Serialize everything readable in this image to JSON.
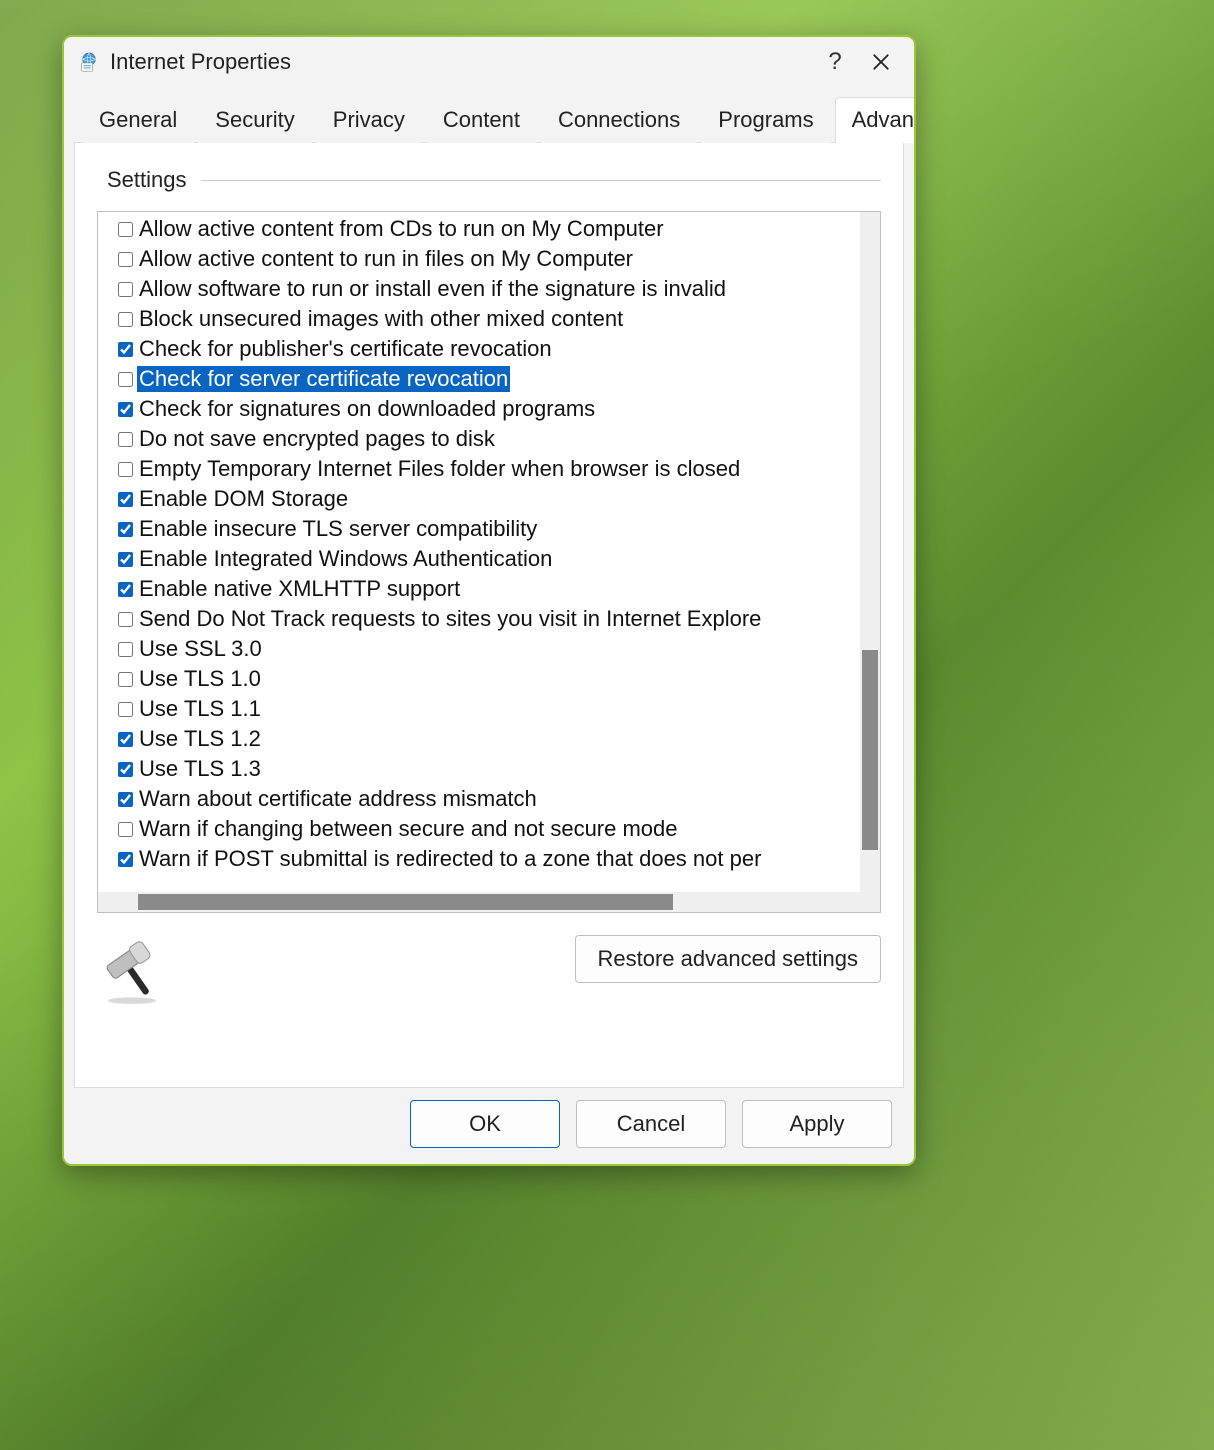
{
  "window": {
    "title": "Internet Properties"
  },
  "tabs": [
    {
      "label": "General",
      "active": false
    },
    {
      "label": "Security",
      "active": false
    },
    {
      "label": "Privacy",
      "active": false
    },
    {
      "label": "Content",
      "active": false
    },
    {
      "label": "Connections",
      "active": false
    },
    {
      "label": "Programs",
      "active": false
    },
    {
      "label": "Advanced",
      "active": true
    }
  ],
  "group": {
    "title": "Settings"
  },
  "settings": [
    {
      "label": "Allow active content from CDs to run on My Computer",
      "checked": false,
      "selected": false
    },
    {
      "label": "Allow active content to run in files on My Computer",
      "checked": false,
      "selected": false
    },
    {
      "label": "Allow software to run or install even if the signature is invalid",
      "checked": false,
      "selected": false
    },
    {
      "label": "Block unsecured images with other mixed content",
      "checked": false,
      "selected": false
    },
    {
      "label": "Check for publisher's certificate revocation",
      "checked": true,
      "selected": false
    },
    {
      "label": "Check for server certificate revocation",
      "checked": false,
      "selected": true
    },
    {
      "label": "Check for signatures on downloaded programs",
      "checked": true,
      "selected": false
    },
    {
      "label": "Do not save encrypted pages to disk",
      "checked": false,
      "selected": false
    },
    {
      "label": "Empty Temporary Internet Files folder when browser is closed",
      "checked": false,
      "selected": false
    },
    {
      "label": "Enable DOM Storage",
      "checked": true,
      "selected": false
    },
    {
      "label": "Enable insecure TLS server compatibility",
      "checked": true,
      "selected": false
    },
    {
      "label": "Enable Integrated Windows Authentication",
      "checked": true,
      "selected": false
    },
    {
      "label": "Enable native XMLHTTP support",
      "checked": true,
      "selected": false
    },
    {
      "label": "Send Do Not Track requests to sites you visit in Internet Explore",
      "checked": false,
      "selected": false
    },
    {
      "label": "Use SSL 3.0",
      "checked": false,
      "selected": false
    },
    {
      "label": "Use TLS 1.0",
      "checked": false,
      "selected": false
    },
    {
      "label": "Use TLS 1.1",
      "checked": false,
      "selected": false
    },
    {
      "label": "Use TLS 1.2",
      "checked": true,
      "selected": false
    },
    {
      "label": "Use TLS 1.3",
      "checked": true,
      "selected": false
    },
    {
      "label": "Warn about certificate address mismatch",
      "checked": true,
      "selected": false
    },
    {
      "label": "Warn if changing between secure and not secure mode",
      "checked": false,
      "selected": false
    },
    {
      "label": "Warn if POST submittal is redirected to a zone that does not per",
      "checked": true,
      "selected": false
    }
  ],
  "buttons": {
    "restore": "Restore advanced settings",
    "ok": "OK",
    "cancel": "Cancel",
    "apply": "Apply"
  }
}
